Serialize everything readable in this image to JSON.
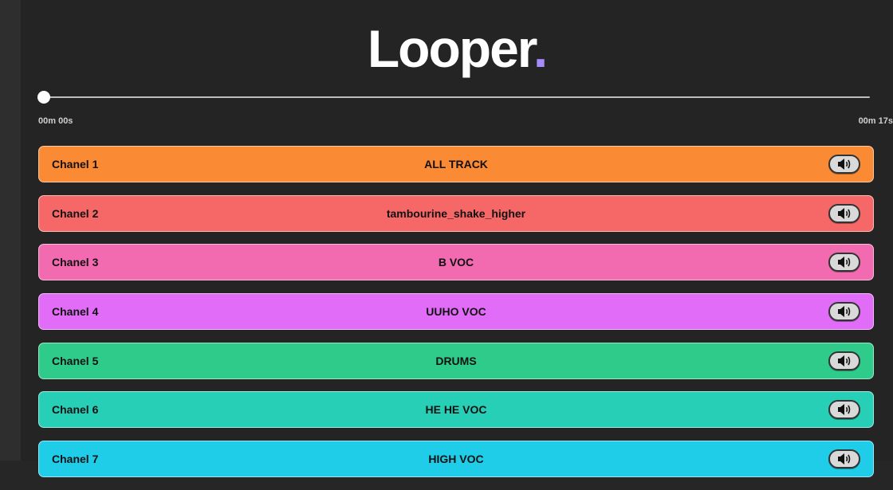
{
  "app": {
    "title": "Looper",
    "title_dot": "."
  },
  "player": {
    "current_time": "00m 00s",
    "total_time": "00m 17s",
    "progress": 0
  },
  "channels": [
    {
      "name": "Chanel 1",
      "track": "ALL TRACK",
      "color": "#fb8a35",
      "icon": "speaker-icon"
    },
    {
      "name": "Chanel 2",
      "track": "tambourine_shake_higher",
      "color": "#f66868",
      "icon": "speaker-icon"
    },
    {
      "name": "Chanel 3",
      "track": "B VOC",
      "color": "#f26ab0",
      "icon": "speaker-icon"
    },
    {
      "name": "Chanel 4",
      "track": "UUHO VOC",
      "color": "#e16cf7",
      "icon": "speaker-icon"
    },
    {
      "name": "Chanel 5",
      "track": "DRUMS",
      "color": "#2ecb8a",
      "icon": "speaker-icon"
    },
    {
      "name": "Chanel 6",
      "track": "HE HE VOC",
      "color": "#27cfb6",
      "icon": "speaker-icon"
    },
    {
      "name": "Chanel 7",
      "track": "HIGH VOC",
      "color": "#1fcde9",
      "icon": "speaker-icon"
    }
  ]
}
